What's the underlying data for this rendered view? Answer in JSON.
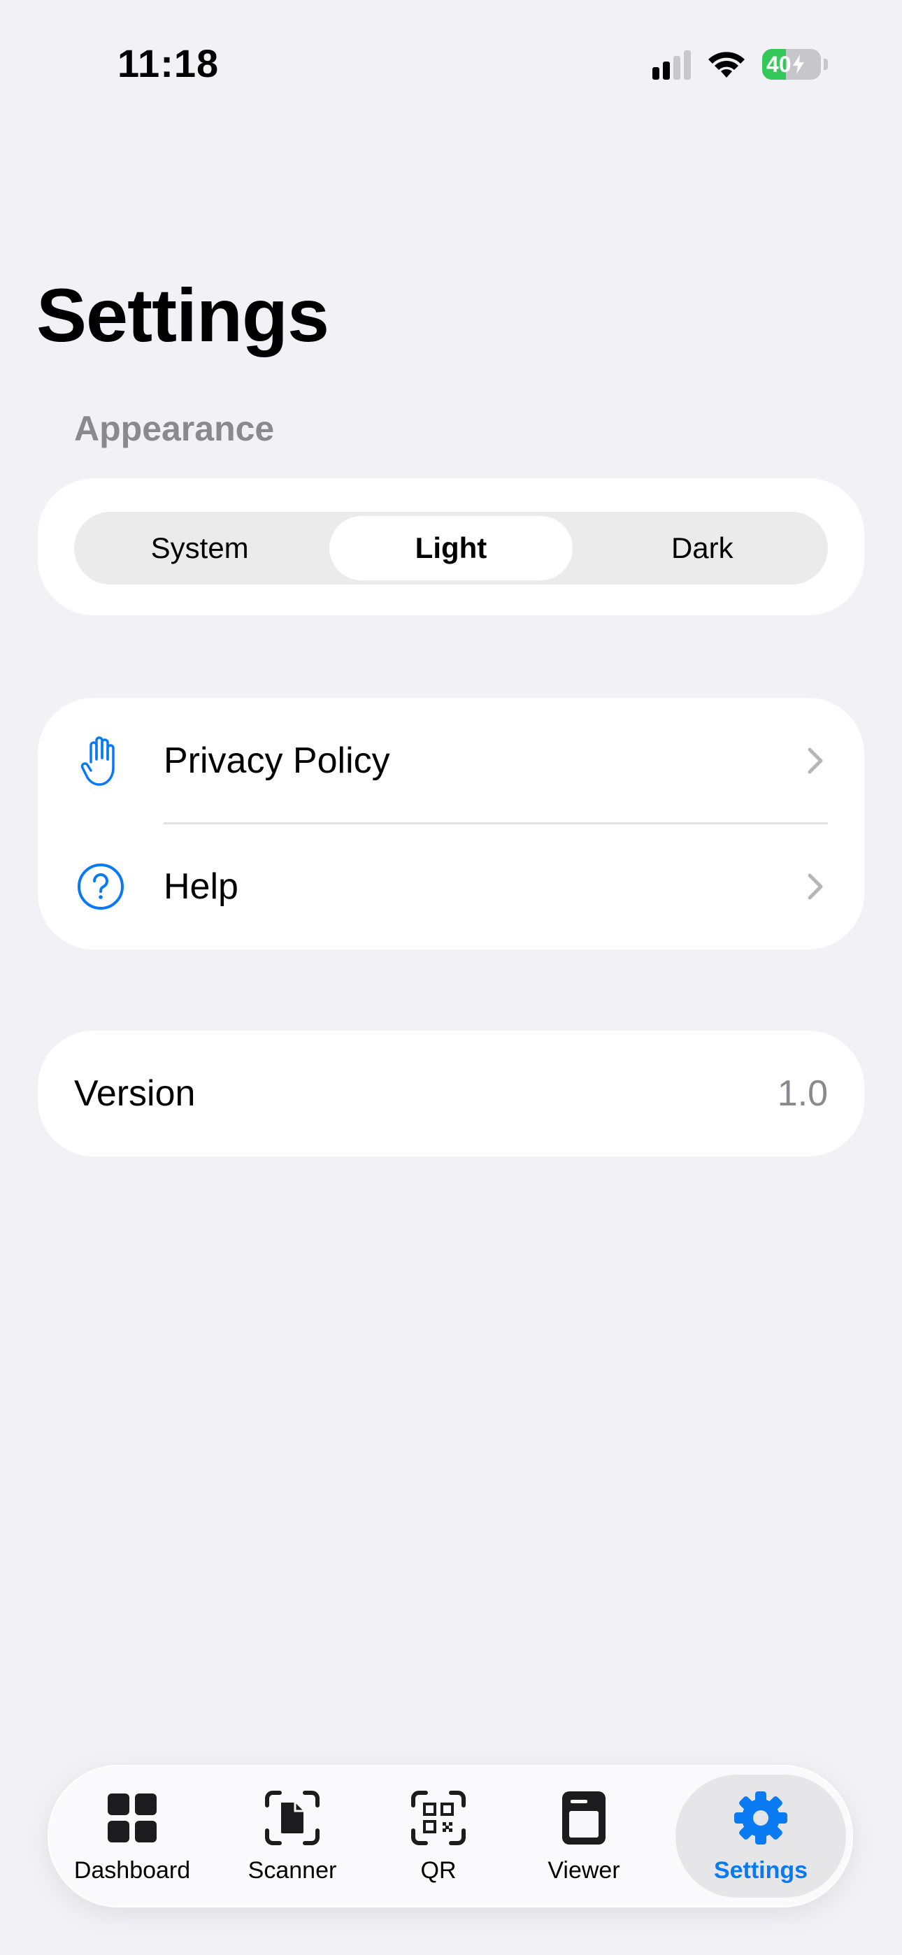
{
  "status_bar": {
    "time": "11:18",
    "battery_percent": "40"
  },
  "page_title": "Settings",
  "appearance": {
    "header": "Appearance",
    "options": [
      "System",
      "Light",
      "Dark"
    ],
    "selected": "Light"
  },
  "links": [
    {
      "label": "Privacy Policy",
      "icon": "hand-raised-icon"
    },
    {
      "label": "Help",
      "icon": "question-circle-icon"
    }
  ],
  "version": {
    "label": "Version",
    "value": "1.0"
  },
  "tabs": [
    {
      "label": "Dashboard",
      "icon": "grid-icon"
    },
    {
      "label": "Scanner",
      "icon": "document-scanner-icon"
    },
    {
      "label": "QR",
      "icon": "qr-code-icon"
    },
    {
      "label": "Viewer",
      "icon": "book-icon"
    },
    {
      "label": "Settings",
      "icon": "gear-icon"
    }
  ],
  "active_tab": "Settings",
  "colors": {
    "accent": "#0A7AF2",
    "battery_green": "#34C759",
    "background": "#F1F1F6"
  }
}
